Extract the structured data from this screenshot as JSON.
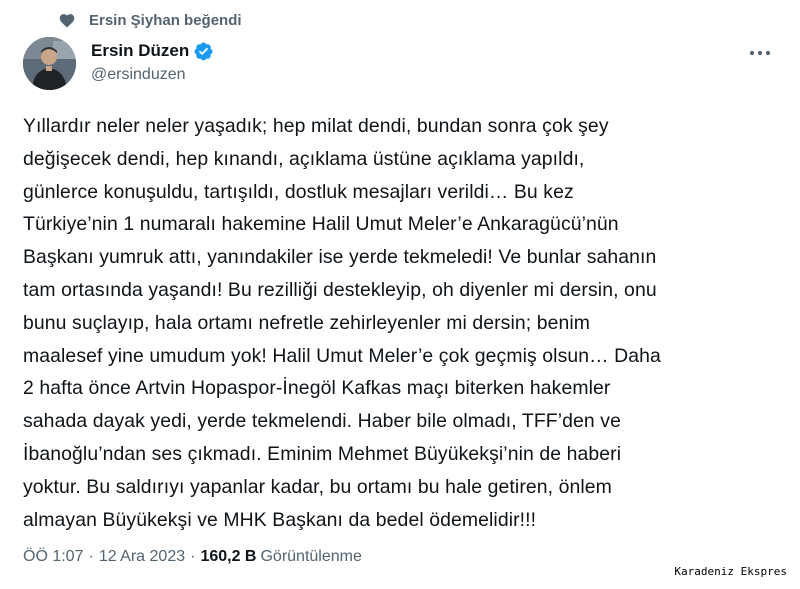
{
  "social_context": {
    "icon": "heart-icon",
    "text": "Ersin Şiyhan beğendi"
  },
  "author": {
    "display_name": "Ersin Düzen",
    "handle": "@ersinduzen",
    "verified": true,
    "verified_color": "#1d9bf0"
  },
  "tweet": {
    "text": "Yıllardır neler neler yaşadık; hep milat dendi, bundan sonra çok şey\ndeğişecek dendi, hep kınandı, açıklama üstüne açıklama yapıldı,\ngünlerce konuşuldu, tartışıldı, dostluk mesajları verildi… Bu kez\nTürkiye’nin 1 numaralı hakemine Halil Umut Meler’e Ankaragücü’nün\nBaşkanı yumruk attı, yanındakiler ise yerde tekmeledi! Ve bunlar sahanın\ntam ortasında yaşandı! Bu rezilliği destekleyip, oh diyenler mi dersin, onu\nbunu suçlayıp, hala  ortamı nefretle zehirleyenler mi  dersin; benim\nmaalesef yine umudum yok! Halil Umut Meler’e çok geçmiş olsun… Daha\n2 hafta önce Artvin Hopaspor-İnegöl Kafkas maçı biterken hakemler\nsahada dayak yedi, yerde tekmelendi. Haber bile olmadı, TFF’den ve\nİbanoğlu’ndan ses çıkmadı. Eminim Mehmet Büyükekşi’nin de haberi\nyoktur. Bu saldırıyı yapanlar kadar, bu ortamı bu hale getiren, önlem\nalmayan Büyükekşi ve MHK Başkanı da bedel ödemelidir!!!"
  },
  "meta": {
    "time": "ÖÖ 1:07",
    "separator": "·",
    "date": "12 Ara 2023",
    "separator2": "·",
    "views_count": "160,2 B",
    "views_label": "Görüntülenme"
  },
  "watermark": "Karadeniz Ekspres",
  "colors": {
    "text_primary": "#0f1419",
    "text_secondary": "#536471",
    "verified_blue": "#1d9bf0"
  }
}
